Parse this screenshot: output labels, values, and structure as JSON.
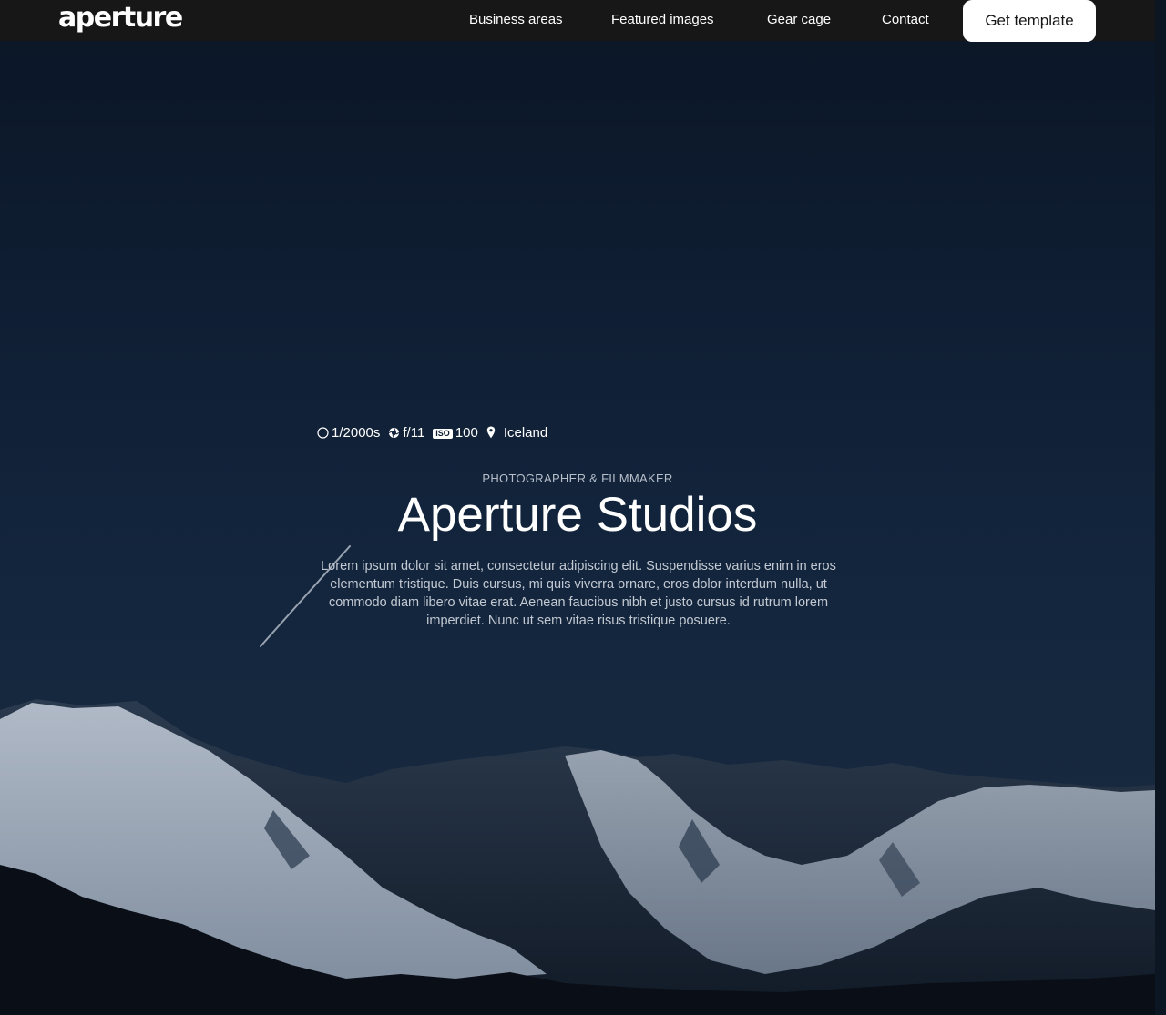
{
  "header": {
    "logo": "aperture",
    "nav": [
      {
        "label": "Business areas"
      },
      {
        "label": "Featured images"
      },
      {
        "label": "Gear cage"
      },
      {
        "label": "Contact"
      }
    ],
    "cta_label": "Get template"
  },
  "camera": {
    "shutter": "1/2000s",
    "aperture": "f/11",
    "iso_badge": "ISO",
    "iso_value": "100",
    "location": "Iceland"
  },
  "hero": {
    "eyebrow": "PHOTOGRAPHER & FILMMAKER",
    "title": "Aperture Studios",
    "body": "Lorem ipsum dolor sit amet, consectetur adipiscing elit. Suspendisse varius enim in eros elementum tristique. Duis cursus, mi quis viverra ornare, eros dolor interdum nulla, ut commodo diam libero vitae erat. Aenean faucibus nibh et justo cursus id rutrum lorem imperdiet. Nunc ut sem vitae risus tristique posuere."
  },
  "colors": {
    "header_bg": "#171717",
    "sky_top": "#0b1626",
    "sky_bottom": "#1a2b40",
    "snow": "#c9d2dd",
    "cta_bg": "#ffffff"
  }
}
